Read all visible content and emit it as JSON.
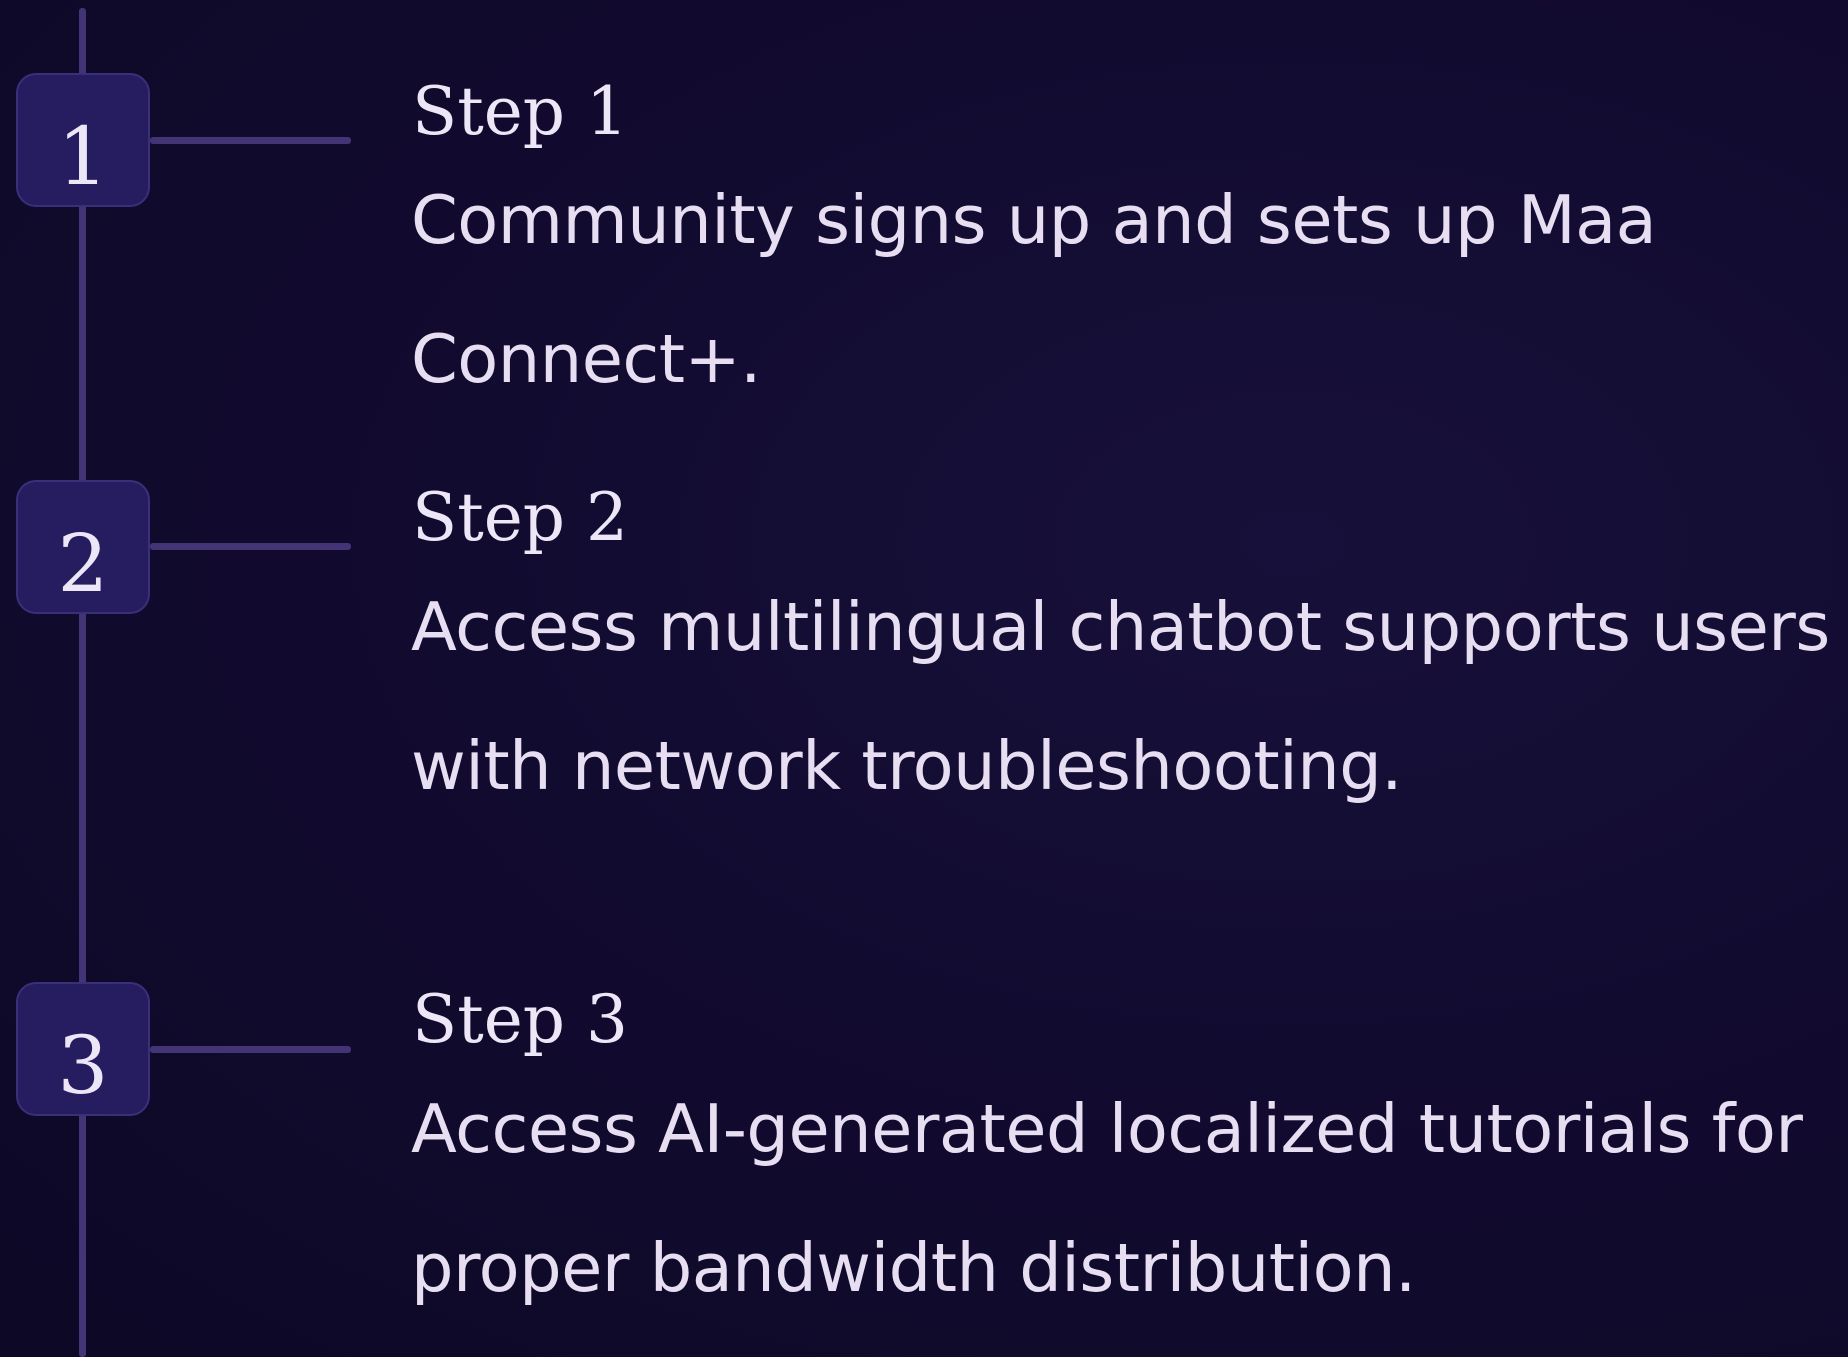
{
  "steps": [
    {
      "number": "1",
      "title": "Step 1",
      "description": "Community signs up and sets up Maa Connect+."
    },
    {
      "number": "2",
      "title": "Step 2",
      "description": "Access multilingual chatbot supports users with network troubleshooting."
    },
    {
      "number": "3",
      "title": "Step 3",
      "description": "Access AI-generated localized tutorials for proper bandwidth distribution."
    }
  ],
  "colors": {
    "background": "#110a2c",
    "line": "#433476",
    "badge_fill": "#261c60",
    "badge_border": "#3b2f7a",
    "text": "#ece6f7"
  }
}
